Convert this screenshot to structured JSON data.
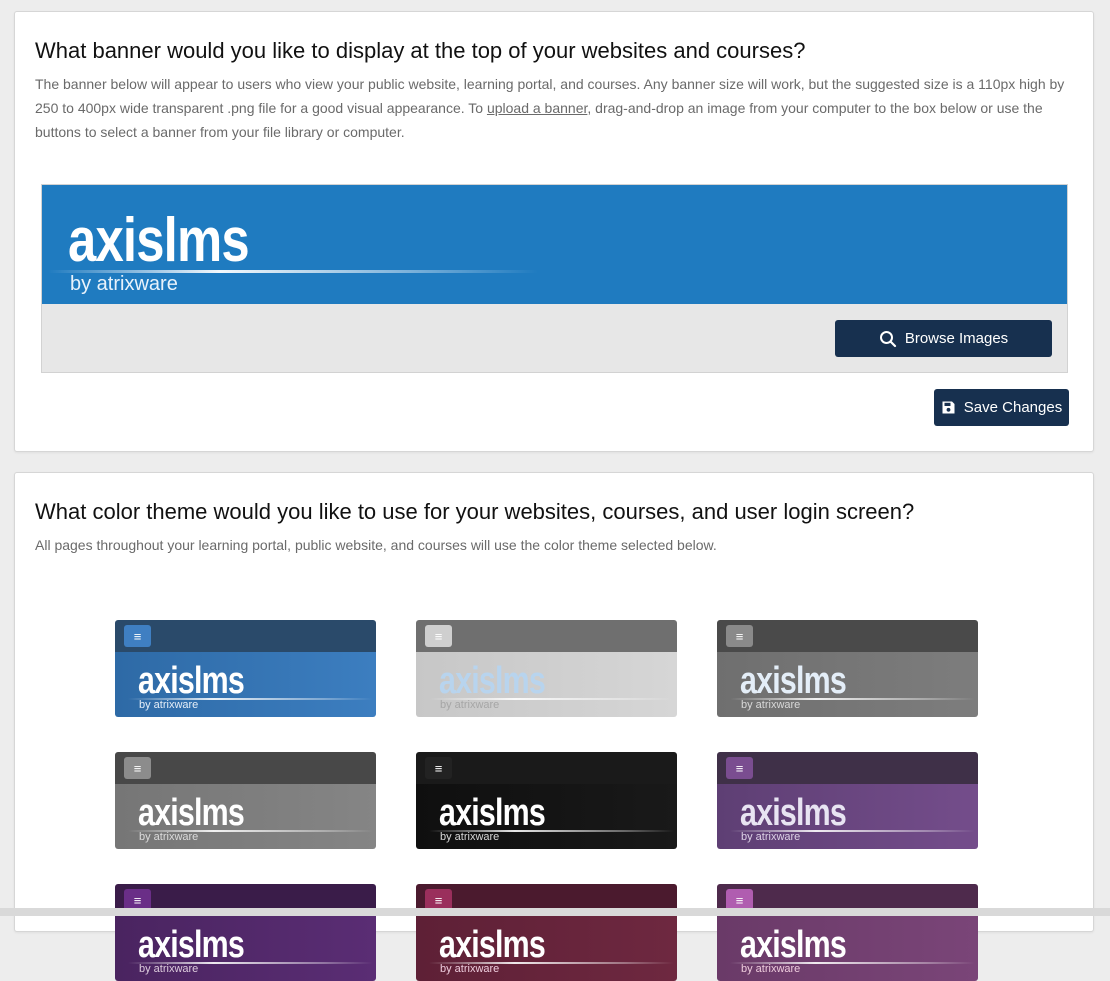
{
  "banner_section": {
    "title": "What banner would you like to display at the top of your websites and courses?",
    "desc_part1": "The banner below will appear to users who view your public website, learning portal, and courses. Any banner size will work, but the suggested size is a 110px high by 250 to 400px wide transparent .png file for a good visual appearance. To ",
    "desc_link": "upload a banner",
    "desc_part2": ", drag-and-drop an image from your computer to the box below or use the buttons to select a banner from your file library or computer.",
    "banner_logo": "axislms",
    "banner_sub": "by atrixware",
    "banner_color": "#1f7bc0",
    "browse_label": "Browse Images",
    "save_label": "Save Changes",
    "button_color": "#17304f"
  },
  "theme_section": {
    "title": "What color theme would you like to use for your websites, courses, and user login screen?",
    "desc": "All pages throughout your learning portal, public website, and courses will use the color theme selected below.",
    "menu_glyph": "≡",
    "tile_logo": "axislms",
    "tile_sub": "by atrixware",
    "themes": [
      {
        "bar": "#2a4a6a",
        "menu": "#3f7fc2",
        "body": "linear-gradient(90deg,#2e6aa6,#3c7ec0)",
        "text": "#ffffff",
        "sub": "#e5eef8"
      },
      {
        "bar": "#6f6f6f",
        "menu": "#cfcfcf",
        "body": "linear-gradient(90deg,#c7c7c7,#d6d6d6)",
        "text": "#b8d4ee",
        "sub": "#a6a6a6"
      },
      {
        "bar": "#4a4a4a",
        "menu": "#8a8a8a",
        "body": "linear-gradient(90deg,#6f6f6f,#7d7d7d)",
        "text": "#e4eef8",
        "sub": "#d8d8d8"
      },
      {
        "bar": "#484848",
        "menu": "#8c8c8c",
        "body": "linear-gradient(90deg,#767676,#858585)",
        "text": "#ffffff",
        "sub": "#dcdcdc"
      },
      {
        "bar": "#1a1a1a",
        "menu": "#222222",
        "body": "linear-gradient(90deg,#0f0f0f,#191919)",
        "text": "#ffffff",
        "sub": "#d8d8d8"
      },
      {
        "bar": "#3f3048",
        "menu": "#7a4d90",
        "body": "linear-gradient(90deg,#5e3f74,#744d8b)",
        "text": "#e8e4f2",
        "sub": "#ddd2e6"
      },
      {
        "bar": "#3a1c49",
        "menu": "#6a2e87",
        "body": "linear-gradient(90deg,#4a2460,#5a2d74)",
        "text": "#ffffff",
        "sub": "#dcd"
      },
      {
        "bar": "#4b1a2e",
        "menu": "#9a2f5c",
        "body": "linear-gradient(90deg,#5e2036,#6e2840)",
        "text": "#ffffff",
        "sub": "#ecd"
      },
      {
        "bar": "#4e2a4c",
        "menu": "#b05db0",
        "body": "linear-gradient(90deg,#6a3a68,#7a4578)",
        "text": "#ffffff",
        "sub": "#ecd"
      }
    ]
  }
}
